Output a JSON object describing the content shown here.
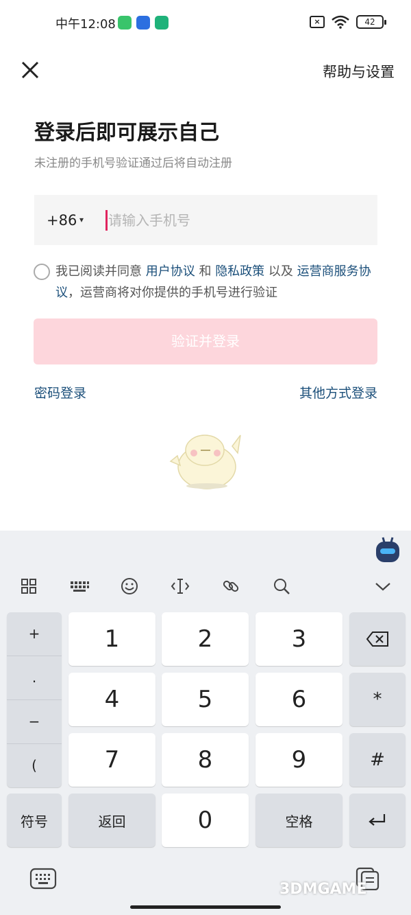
{
  "status_bar": {
    "time": "中午12:08",
    "battery": "42"
  },
  "header": {
    "close_icon": "close-icon",
    "help_label": "帮助与设置"
  },
  "main": {
    "title": "登录后即可展示自己",
    "subtitle": "未注册的手机号验证通过后将自动注册",
    "phone": {
      "country_code": "+86",
      "caret": "▾",
      "placeholder": "请输入手机号",
      "value": ""
    },
    "agreement": {
      "checked": false,
      "t1": "我已阅读并同意 ",
      "user_agreement": "用户协议",
      "t2": " 和 ",
      "privacy_policy": "隐私政策",
      "t3": " 以及 ",
      "carrier_agreement": "运营商服务协议",
      "t4": "，运营商将对你提供的手机号进行验证"
    },
    "login_button": "验证并登录",
    "password_login": "密码登录",
    "other_login": "其他方式登录",
    "accent_color": "#fdd6dc",
    "link_color": "#1b4f7a"
  },
  "keyboard": {
    "toolbar_icons": [
      "grid-icon",
      "keyboard-layout-icon",
      "emoji-icon",
      "cursor-icon",
      "link-icon",
      "search-icon",
      "chevron-down-icon"
    ],
    "symbols": [
      "+",
      ".",
      "−",
      "("
    ],
    "keys": [
      "1",
      "2",
      "3",
      "4",
      "5",
      "6",
      "7",
      "8",
      "9",
      "0"
    ],
    "star": "*",
    "hash": "#",
    "fuhao": "符号",
    "back": "返回",
    "space": "空格",
    "enter_icon": "enter-icon",
    "backspace_icon": "backspace-icon"
  },
  "watermark": "3DMGAME"
}
